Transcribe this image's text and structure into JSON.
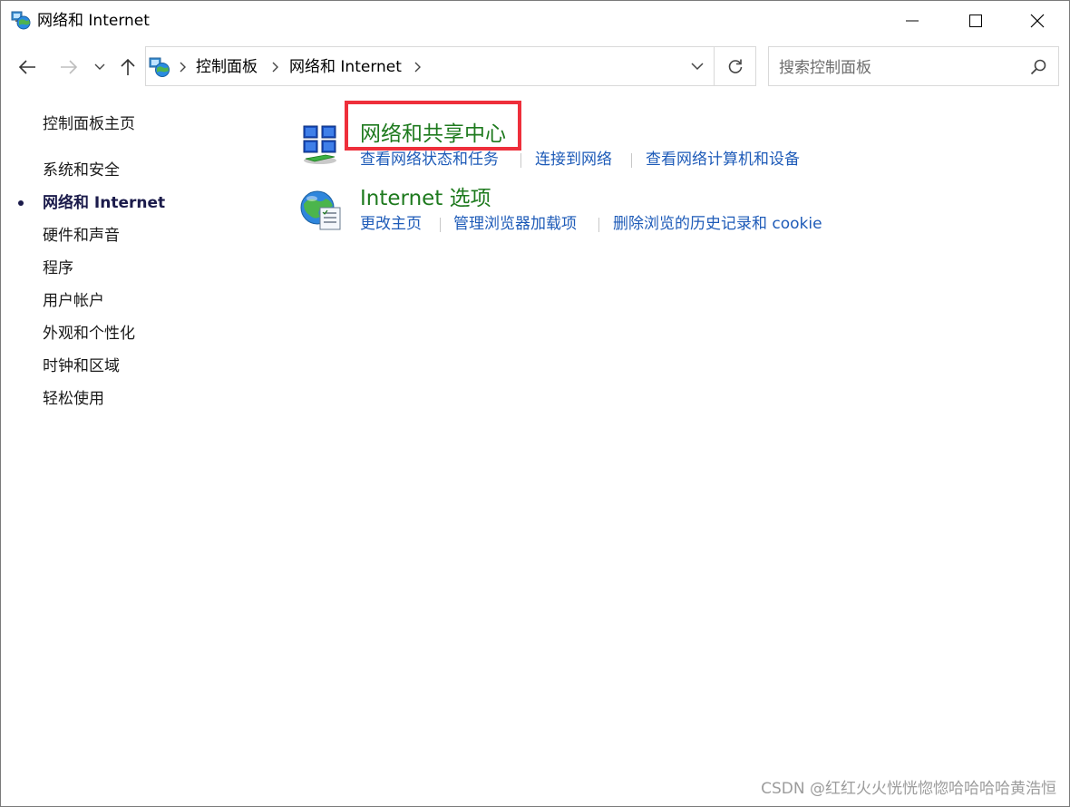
{
  "window": {
    "title": "网络和 Internet",
    "icon": "network-internet-icon"
  },
  "titlebar_controls": {
    "minimize_icon": "minimize-icon",
    "maximize_icon": "maximize-icon",
    "close_icon": "close-icon"
  },
  "navigation": {
    "back_icon": "back-arrow-icon",
    "forward_icon": "forward-arrow-icon",
    "recent_icon": "chevron-down-icon",
    "up_icon": "up-arrow-icon"
  },
  "address_bar": {
    "breadcrumbs": [
      {
        "label": "控制面板"
      },
      {
        "label": "网络和 Internet"
      }
    ],
    "dropdown_icon": "chevron-down-icon",
    "refresh_icon": "refresh-icon"
  },
  "search": {
    "placeholder": "搜索控制面板",
    "icon": "search-icon"
  },
  "sidebar": {
    "home_label": "控制面板主页",
    "items": [
      {
        "label": "系统和安全",
        "active": false
      },
      {
        "label": "网络和 Internet",
        "active": true
      },
      {
        "label": "硬件和声音",
        "active": false
      },
      {
        "label": "程序",
        "active": false
      },
      {
        "label": "用户帐户",
        "active": false
      },
      {
        "label": "外观和个性化",
        "active": false
      },
      {
        "label": "时钟和区域",
        "active": false
      },
      {
        "label": "轻松使用",
        "active": false
      }
    ]
  },
  "categories": [
    {
      "title": "网络和共享中心",
      "icon": "network-sharing-center-icon",
      "highlighted": true,
      "tasks": [
        "查看网络状态和任务",
        "连接到网络",
        "查看网络计算机和设备"
      ]
    },
    {
      "title": "Internet 选项",
      "icon": "internet-options-icon",
      "highlighted": false,
      "tasks": [
        "更改主页",
        "管理浏览器加载项",
        "删除浏览的历史记录和 cookie"
      ]
    }
  ],
  "colors": {
    "category_title": "#1e7a1e",
    "task_link": "#1e5bb8",
    "highlight_box": "#ee2f3b"
  },
  "watermark": "CSDN @红红火火恍恍惚惚哈哈哈哈黄浩恒"
}
